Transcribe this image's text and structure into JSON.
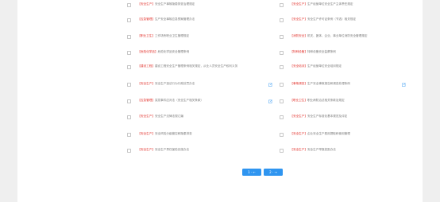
{
  "items": [
    {
      "tag": "【安全生产】",
      "label": "安全生产事故隐患排查治理规定",
      "edit": false
    },
    {
      "tag": "【安全生产】",
      "label": "生产经营单位安全生产主体责任规定",
      "edit": false
    },
    {
      "tag": "【应急管理】",
      "label": "生产安全事故应急预案管理办法",
      "edit": false
    },
    {
      "tag": "【安全生产】",
      "label": "安全生产许可证条例（节选）相关规定",
      "edit": false
    },
    {
      "tag": "【职业卫生】",
      "label": "工作场所职业卫生管理规定",
      "edit": false
    },
    {
      "tag": "【消防安全】",
      "label": "机关、团体、企业、事业单位消防安全管理规定",
      "edit": false
    },
    {
      "tag": "【危险化学品】",
      "label": "危险化学品安全管理条例",
      "edit": false
    },
    {
      "tag": "【特种设备】",
      "label": "特种设备安全监察条例",
      "edit": false
    },
    {
      "tag": "【建设工程】",
      "label": "建设工程安全生产管理条例相关规定，从业人员安全生产权利义务",
      "edit": false
    },
    {
      "tag": "【安全培训】",
      "label": "生产经营单位安全培训规定",
      "edit": false
    },
    {
      "tag": "【安全生产】",
      "label": "安全生产违法行为行政处罚办法",
      "edit": true
    },
    {
      "tag": "【事故调查】",
      "label": "生产安全事故报告和调查处理条例",
      "edit": true
    },
    {
      "tag": "【应急管理】",
      "label": "突发事件应对法（安全生产相关条款）",
      "edit": true
    },
    {
      "tag": "【职业卫生】",
      "label": "职业病防治法相关条款及规定",
      "edit": false
    },
    {
      "tag": "【安全生产】",
      "label": "安全生产法律法规汇编",
      "edit": false
    },
    {
      "tag": "【安全生产】",
      "label": "安全生产标准化基本规范及评定",
      "edit": false
    },
    {
      "tag": "【安全生产】",
      "label": "安全风险分级管控和隐患排查",
      "edit": false
    },
    {
      "tag": "【安全生产】",
      "label": "企业安全生产费用提取和使用管理",
      "edit": false
    },
    {
      "tag": "【安全生产】",
      "label": "安全生产责任保险实施办法",
      "edit": false
    },
    {
      "tag": "【安全生产】",
      "label": "安全生产举报奖励办法",
      "edit": false
    }
  ],
  "pagination": {
    "prev": "1 · ←",
    "next": "2 · →"
  },
  "colors": {
    "accent": "#2f95f0",
    "tag": "#e1302a",
    "background": "#efefef",
    "card": "#ffffff"
  },
  "icons": {
    "edit": "edit-icon",
    "checkbox": "checkbox"
  }
}
